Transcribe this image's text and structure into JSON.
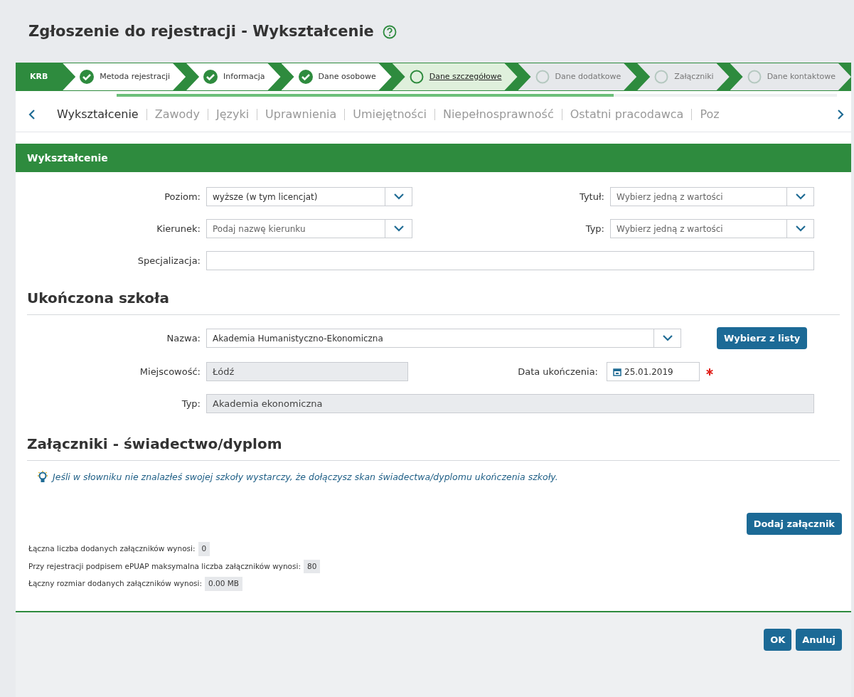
{
  "title": "Zgłoszenie do rejestracji - Wykształcenie",
  "stepper": {
    "badge": "KRB",
    "progress": {
      "level": 0.69
    },
    "steps": [
      {
        "label": "Metoda rejestracji",
        "completed": true,
        "selected": false
      },
      {
        "label": "Informacja",
        "completed": true,
        "selected": false
      },
      {
        "label": "Dane osobowe",
        "completed": true,
        "selected": false
      },
      {
        "label": "Dane szczegółowe",
        "completed": false,
        "selected": true
      },
      {
        "label": "Dane dodatkowe",
        "completed": false,
        "selected": false
      },
      {
        "label": "Załączniki",
        "completed": false,
        "selected": false
      },
      {
        "label": "Dane kontaktowe",
        "completed": false,
        "selected": false
      }
    ]
  },
  "tabs": [
    {
      "label": "Wykształcenie",
      "selected": true
    },
    {
      "label": "Zawody",
      "selected": false
    },
    {
      "label": "Języki",
      "selected": false
    },
    {
      "label": "Uprawnienia",
      "selected": false
    },
    {
      "label": "Umiejętności",
      "selected": false
    },
    {
      "label": "Niepełnosprawność",
      "selected": false
    },
    {
      "label": "Ostatni pracodawca",
      "selected": false
    },
    {
      "label": "Poz",
      "selected": false
    }
  ],
  "panel_title": "Wykształcenie",
  "education_fields": [
    {
      "label": "Poziom:",
      "kind": "select",
      "value": "wyższe (w tym licencjat)"
    },
    {
      "label": "Tytuł:",
      "kind": "select",
      "placeholder": "Wybierz jedną z wartości"
    },
    {
      "label": "Kierunek:",
      "kind": "select",
      "placeholder": "Podaj nazwę kierunku"
    },
    {
      "label": "Typ:",
      "kind": "select",
      "placeholder": "Wybierz jedną z wartości"
    },
    {
      "label": "Specjalizacja:",
      "kind": "input"
    }
  ],
  "school": {
    "heading": "Ukończona szkoła",
    "fields": [
      {
        "label": "Nazwa:",
        "kind": "select",
        "value": "Akademia Humanistyczno-Ekonomiczna"
      },
      {
        "label": "Miejscowość:",
        "kind": "readonly",
        "value": "Łódź"
      },
      {
        "label": "Data ukończenia:",
        "kind": "date",
        "value": "25.01.2019",
        "required": true
      },
      {
        "label": "Typ:",
        "kind": "readonly",
        "value": "Akademia ekonomiczna"
      }
    ],
    "pick_button": "Wybierz z listy"
  },
  "attachments": {
    "heading": "Załączniki - świadectwo/dyplom",
    "hint": "Jeśli w słowniku nie znalazłeś swojej szkoły wystarczy, że dołączysz skan świadectwa/dyplomu ukończenia szkoły.",
    "add_button": "Dodaj załącznik",
    "stats": [
      {
        "label": "Łączna liczba dodanych załączników wynosi:",
        "value": "0"
      },
      {
        "label": "Przy rejestracji podpisem ePUAP maksymalna liczba załączników wynosi:",
        "value": "80"
      },
      {
        "label": "Łączny rozmiar dodanych załączników wynosi:",
        "value": "0.00 MB"
      }
    ]
  },
  "buttons": [
    "OK",
    "Anuluj"
  ]
}
